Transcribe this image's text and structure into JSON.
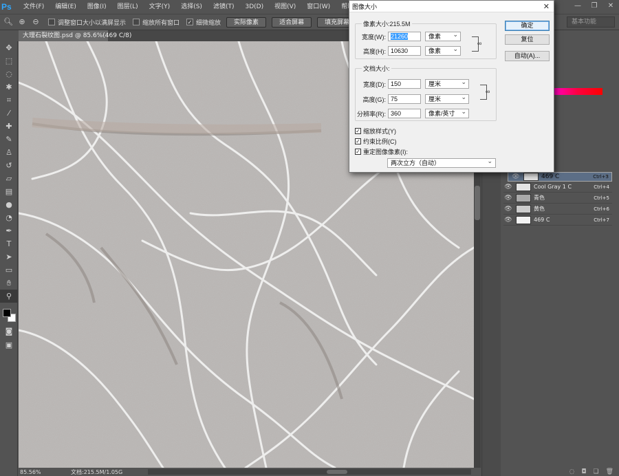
{
  "app": {
    "logo": "Ps"
  },
  "menu": [
    "文件(F)",
    "编辑(E)",
    "图像(I)",
    "图层(L)",
    "文字(Y)",
    "选择(S)",
    "滤镜(T)",
    "3D(D)",
    "视图(V)",
    "窗口(W)",
    "帮助(H)"
  ],
  "window_controls": {
    "minimize": "—",
    "restore": "❐",
    "close": "✕"
  },
  "options": {
    "resize_windows": "调整窗口大小以满屏显示",
    "zoom_all": "缩放所有窗口",
    "scrubby_zoom": "细微缩放",
    "actual_pixels": "实际像素",
    "fit_screen": "适合屏幕",
    "fill_screen": "填充屏幕",
    "workspace": "基本功能"
  },
  "document": {
    "tab_title": "大理石裂纹图.psd @ 85.6%(469 C/8)",
    "zoom": "85.56%",
    "doc_info": "文档:215.5M/1.05G"
  },
  "dialog": {
    "title": "图像大小",
    "pixel_dims_label": "像素大小:215.5M",
    "px_width_label": "宽度(W):",
    "px_width_value": "21260",
    "px_width_unit": "像素",
    "px_height_label": "高度(H):",
    "px_height_value": "10630",
    "px_height_unit": "像素",
    "doc_size_label": "文档大小:",
    "doc_width_label": "宽度(D):",
    "doc_width_value": "150",
    "doc_width_unit": "厘米",
    "doc_height_label": "高度(G):",
    "doc_height_value": "75",
    "doc_height_unit": "厘米",
    "resolution_label": "分辨率(R):",
    "resolution_value": "360",
    "resolution_unit": "像素/英寸",
    "scale_styles": "缩放样式(Y)",
    "constrain": "约束比例(C)",
    "resample": "重定图像像素(I):",
    "resample_method": "两次立方（自动）",
    "ok": "确定",
    "reset": "复位",
    "auto": "自动(A)..."
  },
  "layers": [
    {
      "name": "469 C",
      "shortcut": "Ctrl+3",
      "selected": true
    },
    {
      "name": "Cool Gray 1 C",
      "shortcut": "Ctrl+4",
      "selected": false
    },
    {
      "name": "青色",
      "shortcut": "Ctrl+5",
      "selected": false
    },
    {
      "name": "黄色",
      "shortcut": "Ctrl+6",
      "selected": false
    },
    {
      "name": "469 C",
      "shortcut": "Ctrl+7",
      "selected": false
    }
  ],
  "colors": {
    "selected_layer": "#5c6e86",
    "accent": "#31a8ff"
  }
}
